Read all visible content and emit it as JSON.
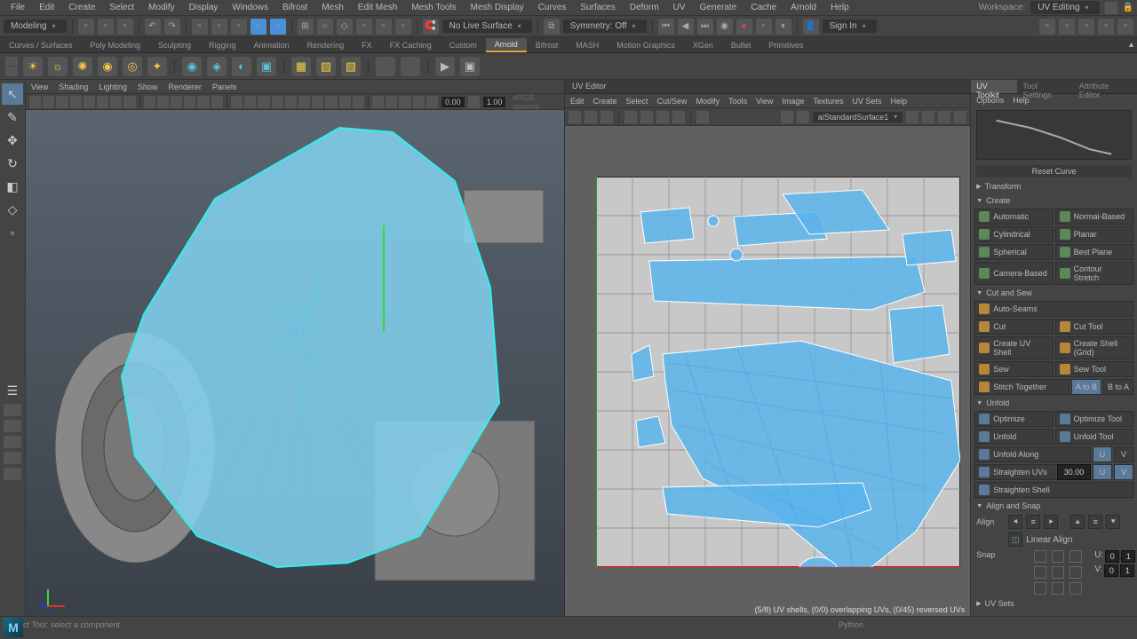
{
  "menubar": [
    "File",
    "Edit",
    "Create",
    "Select",
    "Modify",
    "Display",
    "Windows",
    "Bifrost",
    "Mesh",
    "Edit Mesh",
    "Mesh Tools",
    "Mesh Display",
    "Curves",
    "Surfaces",
    "Deform",
    "UV",
    "Generate",
    "Cache",
    "Arnold",
    "Help"
  ],
  "workspace": {
    "label": "Workspace:",
    "value": "UV Editing"
  },
  "modeDropdown": "Modeling",
  "noLiveSurface": "No Live Surface",
  "symmetry": "Symmetry: Off",
  "signIn": "Sign In",
  "shelfTabs": [
    "Curves / Surfaces",
    "Poly Modeling",
    "Sculpting",
    "Rigging",
    "Animation",
    "Rendering",
    "FX",
    "FX Caching",
    "Custom",
    "Arnold",
    "Bifrost",
    "MASH",
    "Motion Graphics",
    "XGen",
    "Bullet",
    "Primitives"
  ],
  "activeShelfTab": "Arnold",
  "viewportMenu": [
    "View",
    "Shading",
    "Lighting",
    "Show",
    "Renderer",
    "Panels"
  ],
  "vpVals": {
    "a": "0.00",
    "b": "1.00"
  },
  "gamma": "sRGB gamma",
  "uvEditor": {
    "title": "UV Editor",
    "menu": [
      "Edit",
      "Create",
      "Select",
      "Cut/Sew",
      "Modify",
      "Tools",
      "View",
      "Image",
      "Textures",
      "UV Sets",
      "Help"
    ],
    "material": "aiStandardSurface1",
    "status": "(5/8) UV shells, (0/0) overlapping UVs, (0/45) reversed UVs"
  },
  "toolkit": {
    "tabs": [
      "UV Toolkit",
      "Tool Settings",
      "Attribute Editor"
    ],
    "menu": [
      "Options",
      "Help"
    ],
    "resetCurve": "Reset Curve",
    "sections": {
      "transform": "Transform",
      "create": "Create",
      "cutsew": "Cut and Sew",
      "unfold": "Unfold",
      "align": "Align and Snap",
      "uvsets": "UV Sets"
    },
    "create": {
      "automatic": "Automatic",
      "normal": "Normal-Based",
      "cylindrical": "Cylindrical",
      "planar": "Planar",
      "spherical": "Spherical",
      "bestplane": "Best Plane",
      "camera": "Camera-Based",
      "contour": "Contour Stretch"
    },
    "cutsew": {
      "autoseams": "Auto-Seams",
      "cut": "Cut",
      "cuttool": "Cut Tool",
      "createshell": "Create UV Shell",
      "creategrid": "Create Shell (Grid)",
      "sew": "Sew",
      "sewtool": "Sew Tool",
      "stitch": "Stitch Together",
      "atob": "A to B",
      "btoa": "B to A"
    },
    "unfold": {
      "optimize": "Optimize",
      "optimizetool": "Optimize Tool",
      "unfold": "Unfold",
      "unfoldtool": "Unfold Tool",
      "unfoldalong": "Unfold Along",
      "u": "U",
      "v": "V",
      "straighten": "Straighten UVs",
      "straightenval": "30.00",
      "su": "U",
      "sv": "V",
      "straightenshell": "Straighten Shell"
    },
    "align": {
      "align": "Align",
      "linear": "Linear Align",
      "snap": "Snap",
      "ulbl": "U:",
      "vlbl": "V:",
      "n0": "0",
      "n1": "1"
    }
  },
  "status": {
    "hint": "Select Tool: select a component",
    "lang": "Python"
  }
}
